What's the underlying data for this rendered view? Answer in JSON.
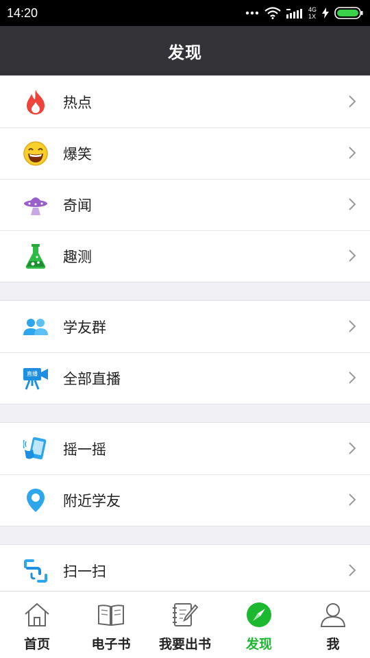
{
  "status_bar": {
    "time": "14:20",
    "network": [
      "4G",
      "1X"
    ]
  },
  "header": {
    "title": "发现"
  },
  "groups": [
    {
      "items": [
        {
          "label": "热点",
          "icon": "fire-icon"
        },
        {
          "label": "爆笑",
          "icon": "laughing-face-icon"
        },
        {
          "label": "奇闻",
          "icon": "ufo-icon"
        },
        {
          "label": "趣测",
          "icon": "flask-icon"
        }
      ]
    },
    {
      "items": [
        {
          "label": "学友群",
          "icon": "group-people-icon"
        },
        {
          "label": "全部直播",
          "icon": "live-camera-icon",
          "icon_text": "直播"
        }
      ]
    },
    {
      "items": [
        {
          "label": "摇一摇",
          "icon": "shake-phone-icon"
        },
        {
          "label": "附近学友",
          "icon": "location-pin-icon"
        }
      ]
    },
    {
      "items": [
        {
          "label": "扫一扫",
          "icon": "scan-icon"
        }
      ]
    }
  ],
  "tabbar": {
    "active": "发现",
    "active_color": "#1cb82f",
    "tabs": [
      {
        "label": "首页",
        "icon": "home-icon"
      },
      {
        "label": "电子书",
        "icon": "open-book-icon"
      },
      {
        "label": "我要出书",
        "icon": "notebook-pen-icon"
      },
      {
        "label": "发现",
        "icon": "compass-icon"
      },
      {
        "label": "我",
        "icon": "user-icon"
      }
    ]
  },
  "colors": {
    "header_bg": "#333337",
    "accent": "#1cb82f",
    "page_bg": "#efeff4"
  }
}
